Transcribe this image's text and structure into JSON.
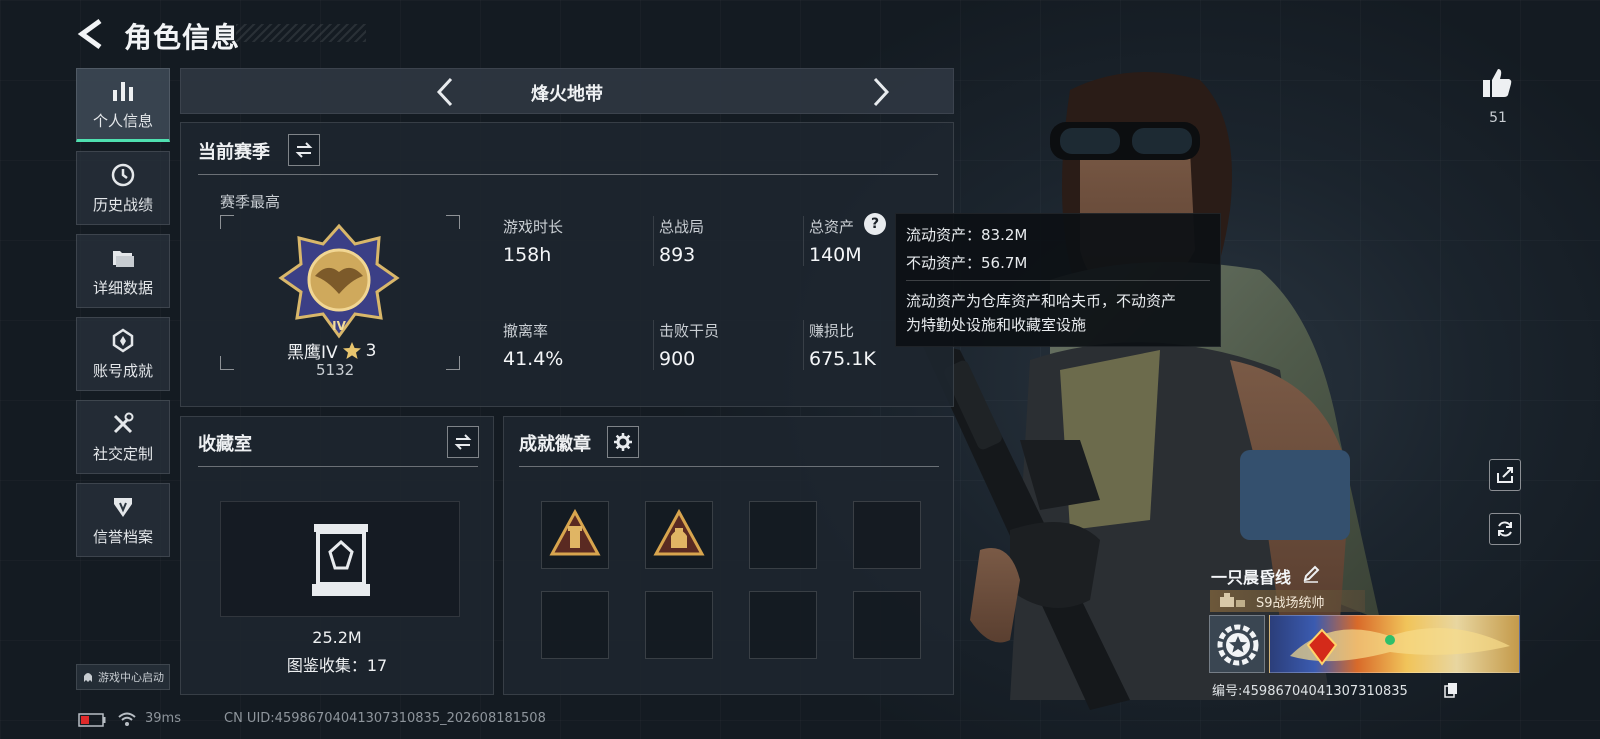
{
  "header": {
    "title": "角色信息"
  },
  "sidebar": {
    "items": [
      {
        "label": "个人信息",
        "icon": "bar-chart-icon",
        "active": true
      },
      {
        "label": "历史战绩",
        "icon": "clock-icon"
      },
      {
        "label": "详细数据",
        "icon": "folder-icon"
      },
      {
        "label": "账号成就",
        "icon": "achievement-icon"
      },
      {
        "label": "社交定制",
        "icon": "tools-icon"
      },
      {
        "label": "信誉档案",
        "icon": "shield-icon"
      }
    ],
    "launch_label": "游戏中心启动"
  },
  "mode": {
    "name": "烽火地带"
  },
  "season": {
    "title": "当前赛季",
    "best_label": "赛季最高",
    "rank_name": "黑鹰IV",
    "rank_stars": "3",
    "rank_score": "5132",
    "rank_numeral": "IV",
    "stats": [
      {
        "label": "游戏时长",
        "value": "158h"
      },
      {
        "label": "总战局",
        "value": "893"
      },
      {
        "label": "总资产",
        "value": "140M"
      },
      {
        "label": "撤离率",
        "value": "41.4%"
      },
      {
        "label": "击败干员",
        "value": "900"
      },
      {
        "label": "赚损比",
        "value": "675.1K"
      }
    ]
  },
  "tooltip": {
    "liquid": "流动资产：83.2M",
    "fixed": "不动资产：56.7M",
    "desc_line1": "流动资产为仓库资产和哈夫币，不动资产",
    "desc_line2": "为特勤处设施和收藏室设施"
  },
  "collection": {
    "title": "收藏室",
    "value": "25.2M",
    "catalog": "图鉴收集：17"
  },
  "badges": {
    "title": "成就徽章",
    "slots": [
      {
        "filled": true,
        "icon": "badge-gold-triangle-icon"
      },
      {
        "filled": true,
        "icon": "badge-gold-triangle-icon"
      },
      {
        "filled": false
      },
      {
        "filled": false
      },
      {
        "filled": false
      },
      {
        "filled": false
      },
      {
        "filled": false
      },
      {
        "filled": false
      }
    ]
  },
  "profile": {
    "likes": "51",
    "name": "一只晨昏线",
    "title_plate": "S9战场统帅",
    "id_text": "编号:45986704041307310835"
  },
  "status": {
    "ping": "39ms",
    "uid": "CN UID:45986704041307310835_202608181508"
  },
  "colors": {
    "accent": "#4fe0b0",
    "panel": "#1e262f",
    "battery": "#e02a2a"
  }
}
